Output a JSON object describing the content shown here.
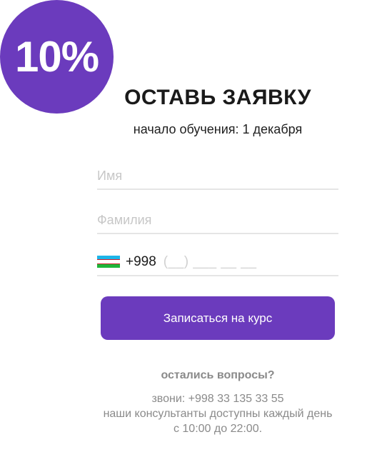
{
  "badge": {
    "text": "10%"
  },
  "form": {
    "title": "ОСТАВЬ ЗАЯВКУ",
    "subtitle": "начало обучения: 1 декабря",
    "first_name_placeholder": "Имя",
    "last_name_placeholder": "Фамилия",
    "phone": {
      "country_flag": "uzbekistan-flag-icon",
      "dial_code": "+998",
      "placeholder": "(__) ___ __ __"
    },
    "submit_label": "Записаться на курс"
  },
  "contact": {
    "question": "остались вопросы?",
    "line1": "звони: +998 33 135 33 55",
    "line2": "наши консультанты доступны каждый день",
    "line3": "с 10:00 до 22:00."
  },
  "colors": {
    "accent": "#6b3bbd",
    "text_dark": "#1a1a1a",
    "text_muted": "#8a8a8a",
    "placeholder": "#c7c7c7",
    "divider": "#e5e5e5"
  }
}
